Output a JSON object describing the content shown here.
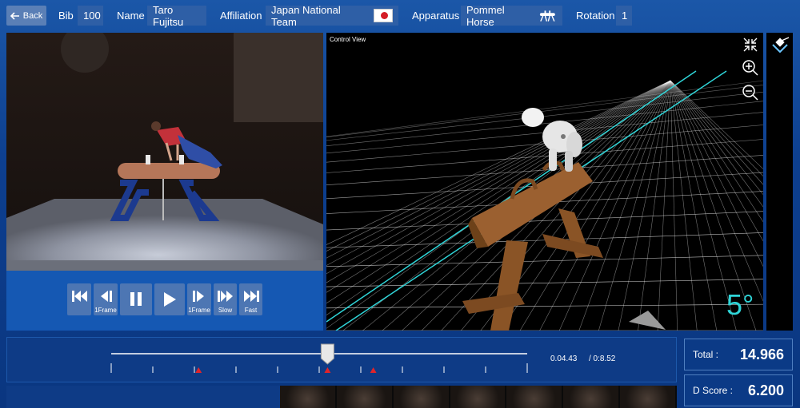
{
  "header": {
    "back_label": "Back",
    "bib_label": "Bib",
    "bib_value": "100",
    "name_label": "Name",
    "name_value": "Taro Fujitsu",
    "affiliation_label": "Affiliation",
    "affiliation_value": "Japan National Team",
    "apparatus_label": "Apparatus",
    "apparatus_value": "Pommel Horse",
    "rotation_label": "Rotation",
    "rotation_value": "1"
  },
  "controls": {
    "buttons": [
      {
        "icon": "skip-start-icon",
        "caption": ""
      },
      {
        "icon": "step-back-icon",
        "caption": "1Frame"
      },
      {
        "icon": "pause-icon",
        "caption": ""
      },
      {
        "icon": "play-icon",
        "caption": ""
      },
      {
        "icon": "step-forward-icon",
        "caption": "1Frame"
      },
      {
        "icon": "slow-icon",
        "caption": "Slow"
      },
      {
        "icon": "fast-icon",
        "caption": "Fast"
      }
    ]
  },
  "view3d": {
    "title": "Control View",
    "angle": "5°"
  },
  "timeline": {
    "current_time": "0.04.43",
    "total_time": "/ 0:8.52",
    "progress": 0.52,
    "marker_color": "#e0242a"
  },
  "scores": {
    "total_label": "Total :",
    "total_value": "14.966",
    "d_label": "D Score :",
    "d_value": "6.200"
  },
  "colors": {
    "accent": "#1558b3",
    "grid_line": "#ffffff",
    "laser": "#2fd5d8"
  }
}
